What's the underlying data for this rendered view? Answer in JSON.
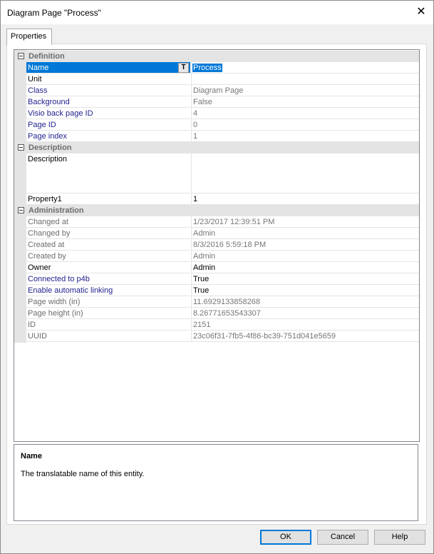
{
  "window": {
    "title": "Diagram Page \"Process\"",
    "close_glyph": "✕"
  },
  "tabs": [
    {
      "label": "Properties"
    }
  ],
  "grid": {
    "categories": {
      "definition": "Definition",
      "description": "Description",
      "administration": "Administration"
    },
    "rows": {
      "name": {
        "label": "Name",
        "value": "Process",
        "translate_glyph": "T"
      },
      "unit": {
        "label": "Unit",
        "value": ""
      },
      "class": {
        "label": "Class",
        "value": "Diagram Page"
      },
      "background": {
        "label": "Background",
        "value": "False"
      },
      "visio_back_page_id": {
        "label": "Visio back page ID",
        "value": "4"
      },
      "page_id": {
        "label": "Page ID",
        "value": "0"
      },
      "page_index": {
        "label": "Page index",
        "value": "1"
      },
      "description": {
        "label": "Description",
        "value": ""
      },
      "property1": {
        "label": "Property1",
        "value": "1"
      },
      "changed_at": {
        "label": "Changed at",
        "value": "1/23/2017 12:39:51 PM"
      },
      "changed_by": {
        "label": "Changed by",
        "value": "Admin"
      },
      "created_at": {
        "label": "Created at",
        "value": "8/3/2016 5:59:18 PM"
      },
      "created_by": {
        "label": "Created by",
        "value": "Admin"
      },
      "owner": {
        "label": "Owner",
        "value": "Admin"
      },
      "connected_to_p4b": {
        "label": "Connected to p4b",
        "value": "True"
      },
      "enable_automatic_linking": {
        "label": "Enable automatic linking",
        "value": "True"
      },
      "page_width": {
        "label": "Page width (in)",
        "value": "11.6929133858268"
      },
      "page_height": {
        "label": "Page height (in)",
        "value": "8.26771653543307"
      },
      "id": {
        "label": "ID",
        "value": "2151"
      },
      "uuid": {
        "label": "UUID",
        "value": "23c06f31-7fb5-4f86-bc39-751d041e5659"
      }
    }
  },
  "help_panel": {
    "title": "Name",
    "text": "The translatable name of this entity."
  },
  "buttons": {
    "ok": "OK",
    "cancel": "Cancel",
    "help": "Help"
  },
  "colors": {
    "selection": "#0078d7",
    "editable_label": "#1f1f8f",
    "readonly_text": "#6d6d6d",
    "category_band": "#e4e4e4"
  }
}
